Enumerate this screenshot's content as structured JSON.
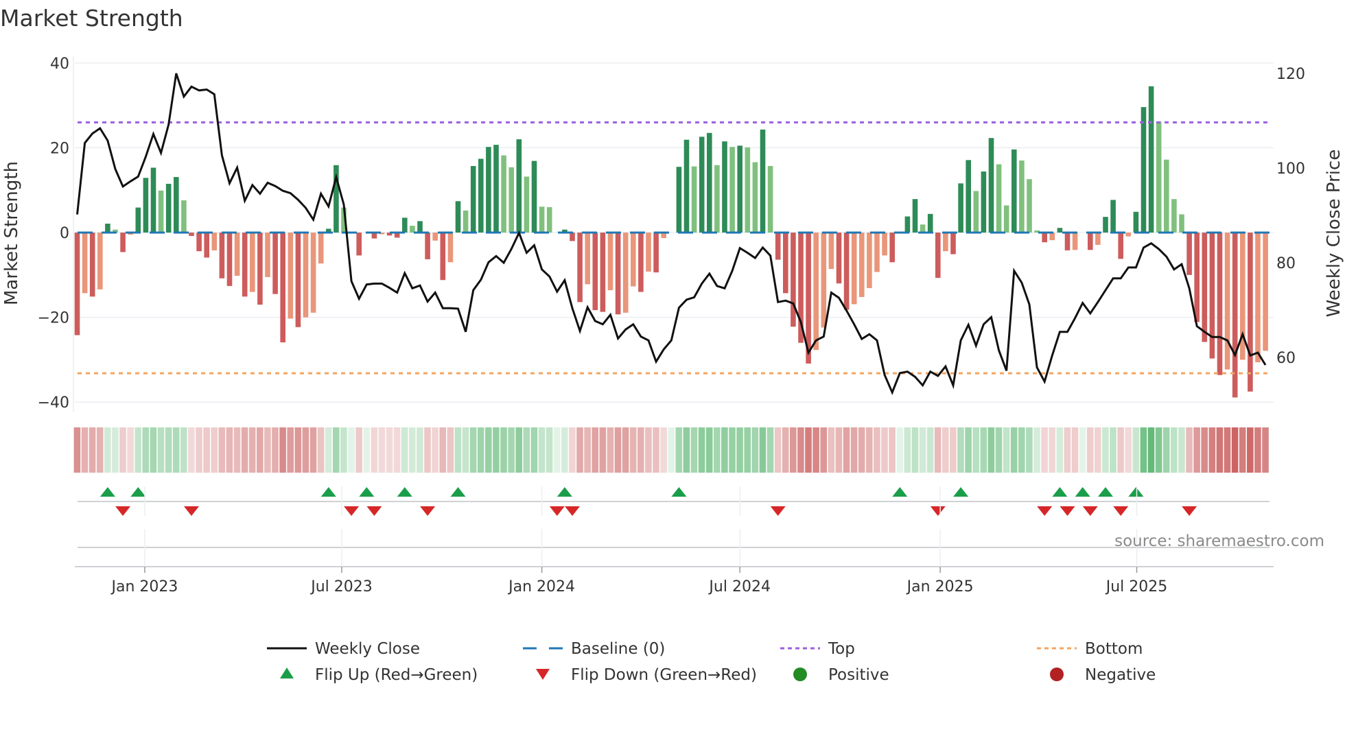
{
  "chart_data": {
    "type": "bar",
    "title": "Market Strength",
    "ylabel": "Market Strength",
    "y2label": "Weekly Close Price",
    "ylim": [
      -41.7,
      41.8
    ],
    "y2lim": [
      48.5,
      123.6
    ],
    "yticks": [
      -40,
      -20,
      0,
      20,
      40
    ],
    "ytick_labels": [
      "−40",
      "−20",
      "0",
      "20",
      "40"
    ],
    "y2ticks": [
      60,
      80,
      100,
      120
    ],
    "y2tick_labels": [
      "60",
      "80",
      "100",
      "120"
    ],
    "x_unit": "week index (0 = first bar)",
    "xticks": [
      8.87,
      34.73,
      61.0,
      87.0,
      113.3,
      139.1
    ],
    "xtick_labels": [
      "Jan 2023",
      "Jul 2023",
      "Jan 2024",
      "Jul 2024",
      "Jan 2025",
      "Jul 2025"
    ],
    "grid": true,
    "top_level": 26.0,
    "bottom_level": -33.2,
    "baseline": 0,
    "strength": [
      -24.2,
      -14.3,
      -15.1,
      -13.4,
      2.1,
      0.7,
      -4.6,
      -0.5,
      5.9,
      12.9,
      15.3,
      9.9,
      11.5,
      13.1,
      7.6,
      -0.8,
      -4.4,
      -5.9,
      -4.2,
      -10.8,
      -12.6,
      -10.2,
      -15.1,
      -14,
      -17,
      -10.5,
      -14.5,
      -25.9,
      -20.3,
      -22.3,
      -20,
      -18.9,
      -7.3,
      0.9,
      15.9,
      5.9,
      0,
      -5.4,
      0,
      -1.4,
      -0.4,
      -0.7,
      -1.2,
      3.5,
      1.6,
      2.7,
      -6.3,
      -1.9,
      -11.2,
      -7.0,
      7.4,
      5.2,
      15.7,
      17.4,
      20.2,
      20.7,
      18.2,
      15.4,
      22.0,
      13.2,
      16.9,
      6.1,
      6.0,
      0,
      0.7,
      -2.0,
      -16.4,
      -12.2,
      -18.3,
      -18.7,
      -13.6,
      -19.3,
      -18.9,
      -12.7,
      -14.0,
      -9.2,
      -9.4,
      -1.3,
      0,
      15.5,
      21.9,
      15.6,
      22.6,
      23.5,
      15.9,
      21.5,
      20.2,
      20.5,
      20.1,
      16.6,
      24.3,
      15.7,
      -6.4,
      -14.3,
      -22.2,
      -26,
      -30.9,
      -27.7,
      -22.4,
      -8.6,
      -12,
      -18.2,
      -16.9,
      -15.2,
      -13.1,
      -9.3,
      -5.4,
      -7.0,
      0,
      3.8,
      7.9,
      1.9,
      4.4,
      -10.7,
      -4.4,
      -5.1,
      11.6,
      17.1,
      9.8,
      14.4,
      22.3,
      16.1,
      6.4,
      19.6,
      17.0,
      12.6,
      0.5,
      -2.3,
      -1.8,
      1.1,
      -4.2,
      -4.1,
      0,
      -4.1,
      -2.9,
      3.7,
      7.7,
      -6.2,
      -0.9,
      4.9,
      29.6,
      34.5,
      26.2,
      17.2,
      7.9,
      4.3,
      -10.0,
      -21.1,
      -25.8,
      -29.7,
      -33.6,
      -32.3,
      -38.9,
      -30,
      -37.5,
      -30.6,
      -27.9
    ],
    "weekly_close": [
      90.2,
      105.3,
      107.3,
      108.4,
      105.8,
      99.8,
      96.1,
      97.2,
      98.2,
      102.4,
      107.2,
      103.2,
      109.2,
      120.0,
      115.1,
      117.2,
      116.4,
      116.6,
      115.6,
      102.7,
      96.8,
      100.1,
      93.1,
      96.4,
      94.6,
      96.9,
      96.2,
      95.2,
      94.7,
      93.3,
      91.6,
      89.1,
      94.6,
      91.9,
      98.1,
      92.3,
      76.1,
      72.4,
      75.4,
      75.6,
      75.6,
      74.7,
      73.7,
      77.8,
      74.6,
      75.2,
      71.8,
      73.7,
      70.4,
      70.4,
      70.3,
      65.4,
      74.2,
      76.4,
      80.1,
      81.4,
      80.0,
      82.9,
      86.3,
      82.1,
      83.7,
      78.6,
      77.1,
      73.9,
      76.3,
      70.4,
      65.6,
      70.6,
      67.7,
      67.0,
      69.0,
      64.0,
      65.9,
      67.0,
      64.4,
      63.6,
      59.1,
      61.7,
      63.6,
      70.5,
      72.2,
      72.7,
      75.6,
      77.7,
      75.1,
      74.6,
      78.3,
      83.1,
      82.1,
      81.0,
      83.2,
      81.5,
      71.7,
      72.0,
      71.4,
      67.5,
      61.0,
      63.6,
      64.4,
      73.7,
      72.6,
      69.9,
      67.0,
      63.9,
      64.9,
      63.6,
      56.3,
      52.6,
      56.7,
      57.0,
      55.9,
      54.1,
      57.0,
      56.1,
      58.1,
      54.1,
      63.6,
      66.9,
      62.5,
      67.0,
      68.5,
      61.5,
      57.2,
      78.3,
      75.8,
      71.2,
      57.9,
      54.9,
      60.4,
      65.4,
      65.4,
      68.3,
      71.5,
      69.3,
      71.7,
      74.2,
      76.7,
      76.7,
      79.0,
      79.0,
      83.2,
      84.1,
      82.9,
      81.3,
      78.6,
      79.7,
      74.6,
      66.6,
      65.4,
      64.3,
      64.3,
      63.6,
      60.5,
      64.9,
      60.4,
      61.0,
      58.4
    ],
    "flip_up_weeks": [
      4,
      8,
      33,
      38,
      43,
      50,
      64,
      79,
      108,
      116,
      129,
      132,
      135,
      139
    ],
    "flip_down_weeks": [
      6,
      15,
      36,
      39,
      46,
      63,
      65,
      92,
      113,
      127,
      130,
      133,
      137,
      146
    ],
    "legend": {
      "placement": "bottom",
      "items": [
        {
          "label": "Weekly Close",
          "kind": "line"
        },
        {
          "label": "Baseline (0)",
          "kind": "dash"
        },
        {
          "label": "Top",
          "kind": "dot-top"
        },
        {
          "label": "Bottom",
          "kind": "dot-bottom"
        },
        {
          "label": "Flip Up (Red→Green)",
          "kind": "tri-up"
        },
        {
          "label": "Flip Down (Green→Red)",
          "kind": "tri-down"
        },
        {
          "label": "Positive",
          "kind": "circle-pos"
        },
        {
          "label": "Negative",
          "kind": "circle-neg"
        }
      ]
    },
    "annotation": "source: sharemaestro.com"
  },
  "colors": {
    "pos_dark": "#2e8b57",
    "pos_light": "#80c07e",
    "neg_dark": "#cd5c5c",
    "neg_light": "#e9967a",
    "heat_pos": "#4caf64",
    "heat_neg": "#c85a5a",
    "price": "#111111",
    "baseline": "#1f77b4",
    "top": "#9b5fe0",
    "bottom": "#f4a460",
    "flip_up": "#1a9e4a",
    "flip_down": "#d62728",
    "legend_pos": "#228b22",
    "legend_neg": "#b22222"
  }
}
